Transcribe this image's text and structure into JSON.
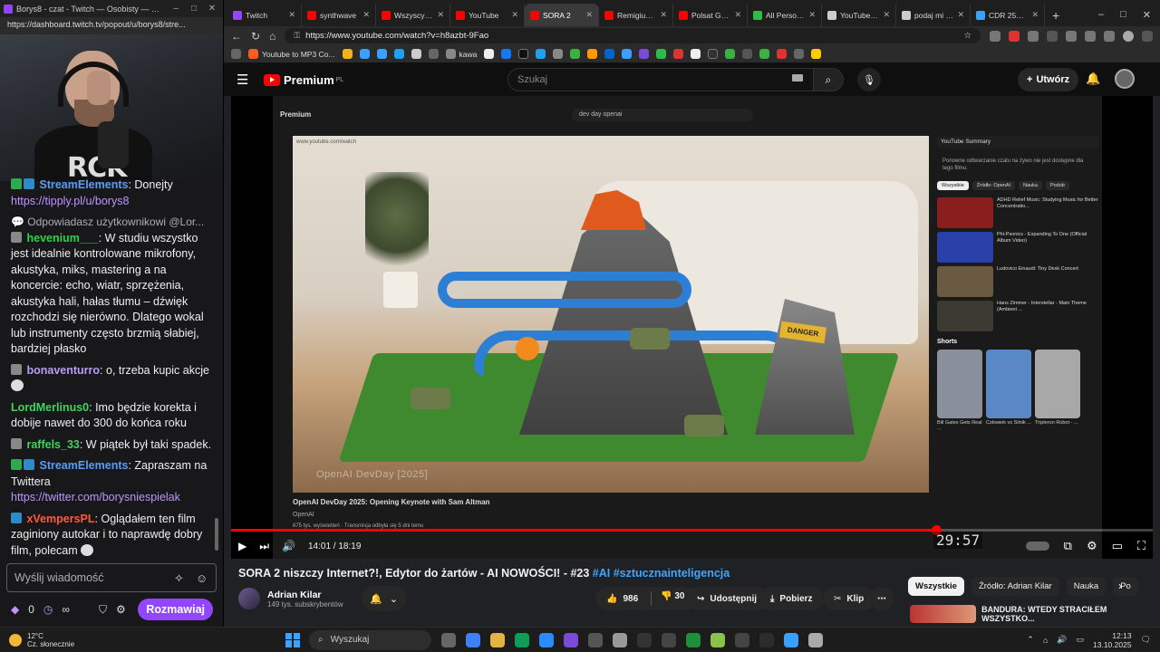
{
  "twitch": {
    "window_title": "Borys8 - czat - Twitch — Osobisty — Mic...",
    "url": "https://dashboard.twitch.tv/popout/u/borys8/stre...",
    "messages": [
      {
        "user": "StreamElements",
        "user_color": "#5a9cf3",
        "text": ": Donejty",
        "link": "https://tipply.pl/u/borys8"
      },
      {
        "reply": "Odpowiadasz użytkownikowi @Lor...",
        "user": "hevenium___",
        "user_color": "#32d04a",
        "text": ": W studiu wszystko jest idealnie kontrolowane mikrofony, akustyka, miks, mastering a na koncercie: echo, wiatr, sprzężenia, akustyka hali, hałas tłumu – dźwięk rozchodzi się nierówno. Dlatego wokal lub instrumenty często brzmią słabiej, bardziej płasko"
      },
      {
        "user": "bonaventurro",
        "user_color": "#b49ef8",
        "text": ": o, trzeba kupic akcje"
      },
      {
        "user": "LordMerlinus0",
        "user_color": "#3fd35f",
        "text": ": Imo będzie korekta i dobije nawet do 300 do końca roku"
      },
      {
        "user": "raffels_33",
        "user_color": "#3fd35f",
        "text": ": W piątek był taki spadek."
      },
      {
        "user": "StreamElements",
        "user_color": "#5a9cf3",
        "text": ": Zapraszam na Twittera",
        "link": "https://twitter.com/borysniespielak"
      },
      {
        "user": "xVempersPL",
        "user_color": "#ff5a3c",
        "text": ": Oglądałem ten film zaginiony autokar i to naprawdę dobry film, polecam"
      }
    ],
    "input_placeholder": "Wyślij wiadomość",
    "points": "0",
    "infinity": "∞",
    "send_label": "Rozmawiaj"
  },
  "browser": {
    "tabs": [
      {
        "label": "Twitch",
        "color": "#9147ff"
      },
      {
        "label": "synthwave",
        "color": "#ff0000"
      },
      {
        "label": "Wszyscy gra",
        "color": "#ff0000"
      },
      {
        "label": "YouTube",
        "color": "#ff0000"
      },
      {
        "label": "SORA 2",
        "color": "#ff0000",
        "active": true
      },
      {
        "label": "Remigiusz M",
        "color": "#ff0000"
      },
      {
        "label": "Polsat Game",
        "color": "#ff0000"
      },
      {
        "label": "All Personal",
        "color": "#2fbd4a"
      },
      {
        "label": "YouTube day",
        "color": "#cccccc"
      },
      {
        "label": "podaj mi listi",
        "color": "#cccccc"
      },
      {
        "label": "CDR 256,50",
        "color": "#3aa0ff"
      }
    ],
    "url": "https://www.youtube.com/watch?v=h8azbt-9Fao",
    "bookmarks": [
      {
        "label": "Youtube to MP3 Co...",
        "color": "#ff5a1f"
      },
      {
        "label": "kawa",
        "color": "#888888"
      }
    ]
  },
  "youtube": {
    "logo": "Premium",
    "logo_sup": "PL",
    "search_placeholder": "Szukaj",
    "create_label": "Utwórz",
    "player": {
      "time": "14:01 / 18:19",
      "progress": 0.765,
      "inner_timer": "29:57",
      "inner_search": "dev day openai",
      "inner_logo": "Premium",
      "inner_url": "www.youtube.com/watch",
      "inner_title": "OpenAI DevDay 2025: Opening Keynote with Sam Altman",
      "inner_channel": "OpenAI",
      "inner_desc": "675 tys. wyświetleń · Transmisja odbyła się 5 dni temu",
      "watermark": "OpenAI DevDay [2025]",
      "danger": "DANGER",
      "side_summary": "YouTube Summary",
      "side_note": "Ponowne odtwarzanie czatu na żywo nie jest dostępne dla tego filmu.",
      "side_chips": [
        "Wszystkie",
        "Źródło: OpenAI",
        "Nauka",
        "Podob"
      ],
      "side_recs": [
        {
          "title": "ADHD Relief Music: Studying Music for Better Concentratio...",
          "color": "#8a1d1d"
        },
        {
          "title": "Phi-Psonics - Expanding To One (Official Album Video)",
          "color": "#2b3fa8"
        },
        {
          "title": "Ludovico Einaudi: Tiny Desk Concert",
          "color": "#6a5a42"
        },
        {
          "title": "Hans Zimmer - Interstellar - Main Theme (Ambient ...",
          "color": "#3b3b32"
        }
      ],
      "shorts_title": "Shorts",
      "shorts": [
        {
          "title": "Bill Gates Gets Real ...",
          "color": "#8a8f9c"
        },
        {
          "title": "Człowiek vs Silnik ...",
          "color": "#5a88c7"
        },
        {
          "title": "Tripteron Robot - ...",
          "color": "#a8a8a8"
        }
      ]
    },
    "title_main": "SORA 2 niszczy Internet?!, Edytor do żartów - AI NOWOŚCI! - #23 ",
    "title_tags": "#AI #sztucznainteligencja",
    "channel_name": "Adrian Kilar",
    "channel_subs": "149 tys. subskrybentów",
    "likes": "986",
    "dislikes": "30",
    "share": "Udostępnij",
    "download": "Pobierz",
    "clip": "Klip",
    "chips": [
      "Wszystkie",
      "Źródło: Adrian Kilar",
      "Nauka",
      "Po"
    ],
    "next_title": "BANDURA: WTEDY STRACIŁEM WSZYSTKO..."
  },
  "taskbar": {
    "temp": "12°C",
    "weather": "Cz. słonecznie",
    "search": "Wyszukaj",
    "time": "12:13",
    "date": "13.10.2025",
    "apps": [
      "#666666",
      "#3b82f6",
      "#e3b341",
      "#0f9d58",
      "#2a8cff",
      "#7a4bd6",
      "#555555",
      "#999999",
      "#333333",
      "#444444",
      "#1f8f3a",
      "#8bc34a",
      "#444444",
      "#2c2c2c",
      "#3aa0ff",
      "#aaaaaa"
    ]
  }
}
